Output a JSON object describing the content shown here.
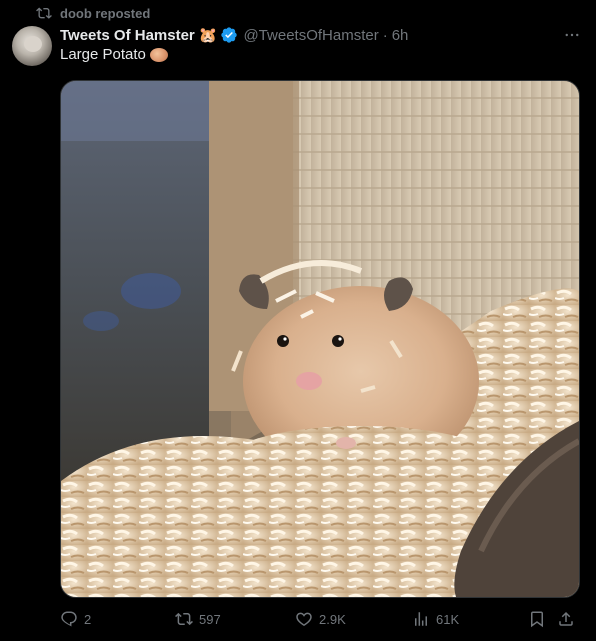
{
  "repost": {
    "text": "doob reposted"
  },
  "author": {
    "display_name": "Tweets Of Hamster",
    "emoji": "🐹",
    "handle": "@TweetsOfHamster",
    "separator": "·",
    "time": "6h",
    "verified": true
  },
  "tweet": {
    "text": "Large Potato",
    "emoji_icon": "potato-icon"
  },
  "media": {
    "subject": "hamster in wood shavings"
  },
  "actions": {
    "replies": "2",
    "reposts": "597",
    "likes": "2.9K",
    "views": "61K"
  },
  "colors": {
    "background": "#000000",
    "text": "#e7e9ea",
    "muted": "#71767b",
    "verified": "#1d9bf0"
  }
}
